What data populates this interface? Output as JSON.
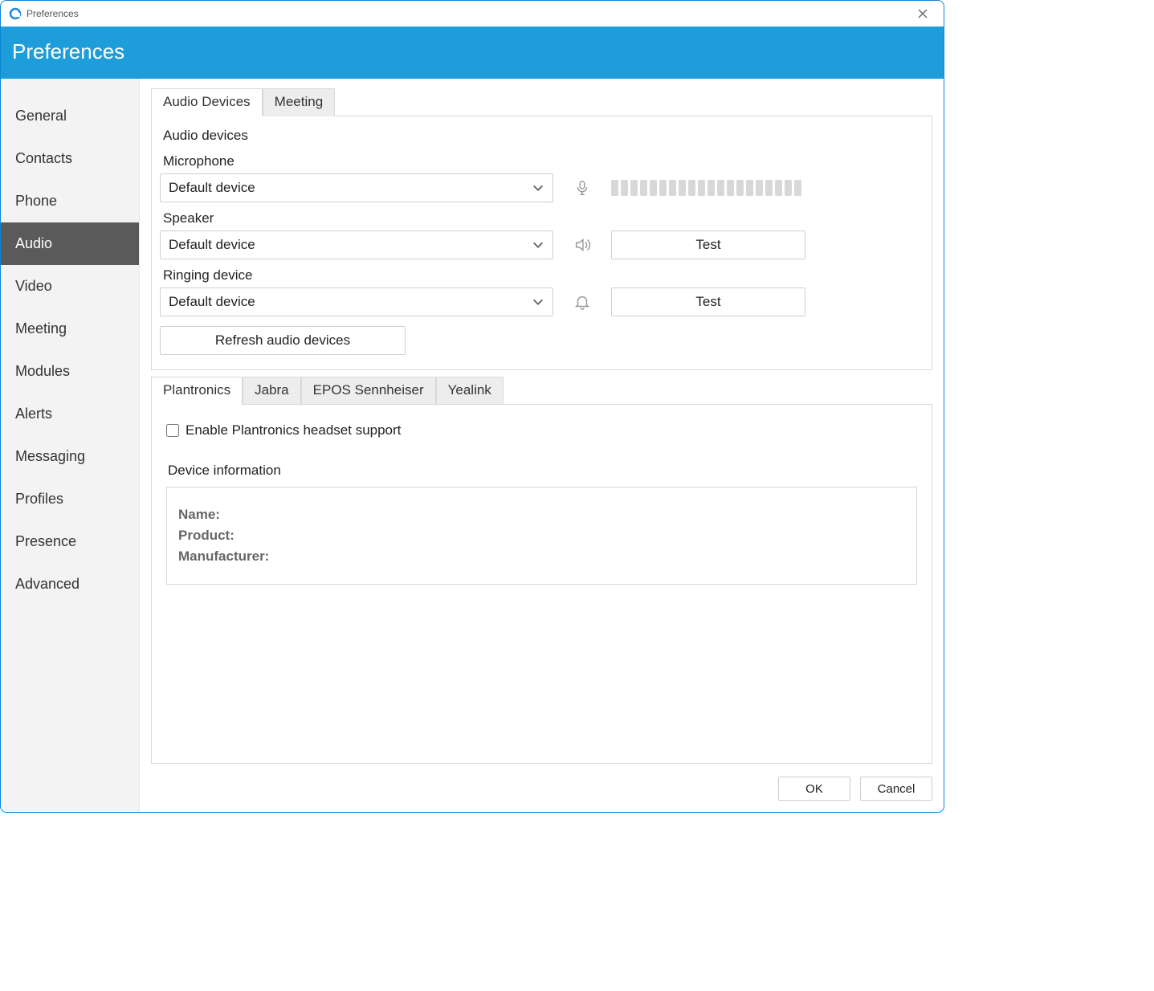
{
  "window": {
    "title": "Preferences"
  },
  "banner": {
    "title": "Preferences"
  },
  "sidebar": {
    "items": [
      {
        "label": "General"
      },
      {
        "label": "Contacts"
      },
      {
        "label": "Phone"
      },
      {
        "label": "Audio"
      },
      {
        "label": "Video"
      },
      {
        "label": "Meeting"
      },
      {
        "label": "Modules"
      },
      {
        "label": "Alerts"
      },
      {
        "label": "Messaging"
      },
      {
        "label": "Profiles"
      },
      {
        "label": "Presence"
      },
      {
        "label": "Advanced"
      }
    ],
    "active_index": 3
  },
  "tabs": [
    {
      "label": "Audio Devices"
    },
    {
      "label": "Meeting"
    }
  ],
  "active_tab_index": 0,
  "audio_section": {
    "title": "Audio devices",
    "microphone": {
      "label": "Microphone",
      "value": "Default device"
    },
    "speaker": {
      "label": "Speaker",
      "value": "Default device",
      "test_label": "Test"
    },
    "ringing": {
      "label": "Ringing device",
      "value": "Default device",
      "test_label": "Test"
    },
    "refresh_label": "Refresh audio devices"
  },
  "headset_tabs": [
    {
      "label": "Plantronics"
    },
    {
      "label": "Jabra"
    },
    {
      "label": "EPOS Sennheiser"
    },
    {
      "label": "Yealink"
    }
  ],
  "headset_active_index": 0,
  "headset_panel": {
    "checkbox_label": "Enable Plantronics headset support",
    "devinfo_title": "Device information",
    "name_label": "Name:",
    "product_label": "Product:",
    "manufacturer_label": "Manufacturer:"
  },
  "footer": {
    "ok": "OK",
    "cancel": "Cancel"
  }
}
